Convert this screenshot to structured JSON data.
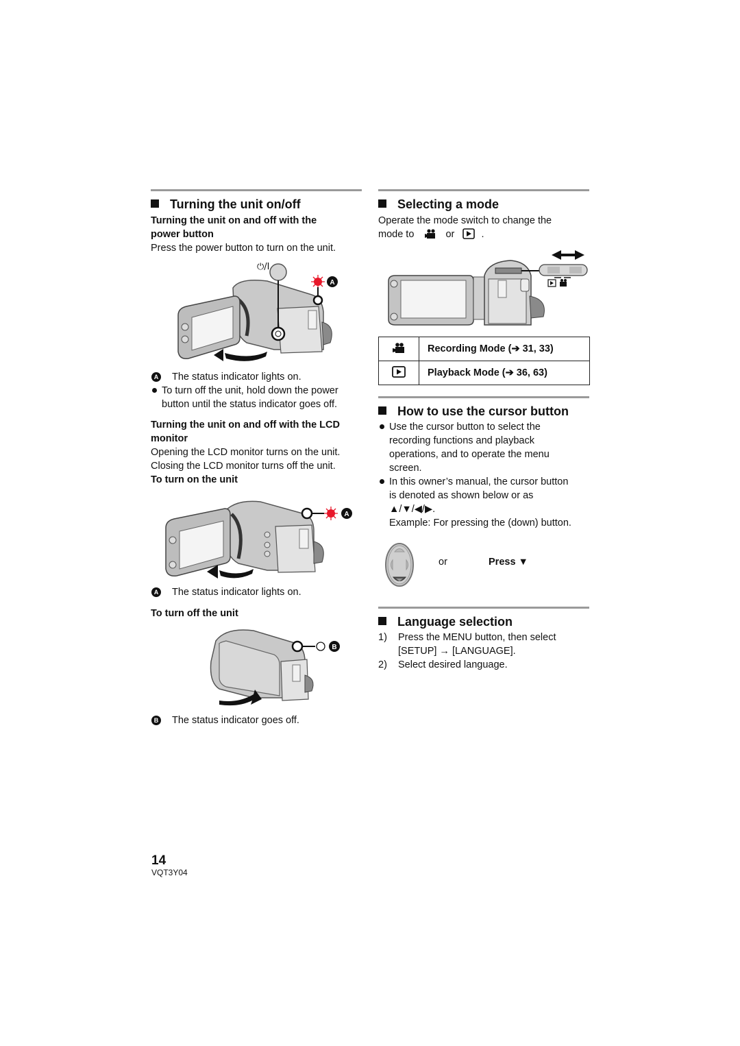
{
  "left_column": {
    "section_turning": {
      "title": "Turning the unit on/off",
      "sub_power_line1": "Turning the unit on and off with the",
      "sub_power_line2": "power button",
      "power_instruction": "Press the power button to turn on the unit.",
      "figure1": {
        "power_symbol_label": "⏻/I",
        "callout_a": "A"
      },
      "legend_a_1": {
        "marker": "A",
        "text": "The status indicator lights on."
      },
      "bullet_off_line1": "To turn off the unit, hold down the power",
      "bullet_off_line2": "button until the status indicator goes off.",
      "sub_lcd_line1": "Turning the unit on and off with the LCD",
      "sub_lcd_line2": "monitor",
      "lcd_text_line1": "Opening the LCD monitor turns on the unit.",
      "lcd_text_line2": "Closing the LCD monitor turns off the unit.",
      "to_turn_on": "To turn on the unit",
      "figure2": {
        "callout_a": "A"
      },
      "legend_a_2": {
        "marker": "A",
        "text": "The status indicator lights on."
      },
      "to_turn_off": "To turn off the unit",
      "figure3": {
        "callout_b": "B"
      },
      "legend_b": {
        "marker": "B",
        "text": "The status indicator goes off."
      }
    }
  },
  "right_column": {
    "section_mode": {
      "title": "Selecting a mode",
      "text_line1": "Operate the mode switch to change the",
      "text_line2_prefix": "mode to",
      "text_line2_or": "or",
      "text_line2_suffix": ".",
      "table": [
        {
          "icon": "recording-mode-icon",
          "label": "Recording Mode (➔ 31, 33)"
        },
        {
          "icon": "playback-mode-icon",
          "label": "Playback Mode (➔ 36, 63)"
        }
      ]
    },
    "section_cursor": {
      "title": "How to use the cursor button",
      "bullet1": [
        "Use the cursor button to select the",
        "recording functions and playback",
        "operations, and to operate the menu",
        "screen."
      ],
      "bullet2": [
        "In this owner’s manual, the cursor button",
        "is denoted as shown below or as",
        "▲/▼/◀/▶."
      ],
      "example": "Example: For pressing the (down) button.",
      "or_label": "or",
      "press_label": "Press ▼"
    },
    "section_language": {
      "title": "Language selection",
      "steps": [
        {
          "num": "1)",
          "lines": [
            "Press the MENU button, then select",
            "[SETUP] → [LANGUAGE]."
          ]
        },
        {
          "num": "2)",
          "lines": [
            "Select desired language."
          ]
        }
      ]
    }
  },
  "footer": {
    "page_number": "14",
    "model_code": "VQT3Y04"
  },
  "colors": {
    "rule": "#9a9a9a",
    "indicator_red": "#e8182a",
    "text": "#111111"
  }
}
